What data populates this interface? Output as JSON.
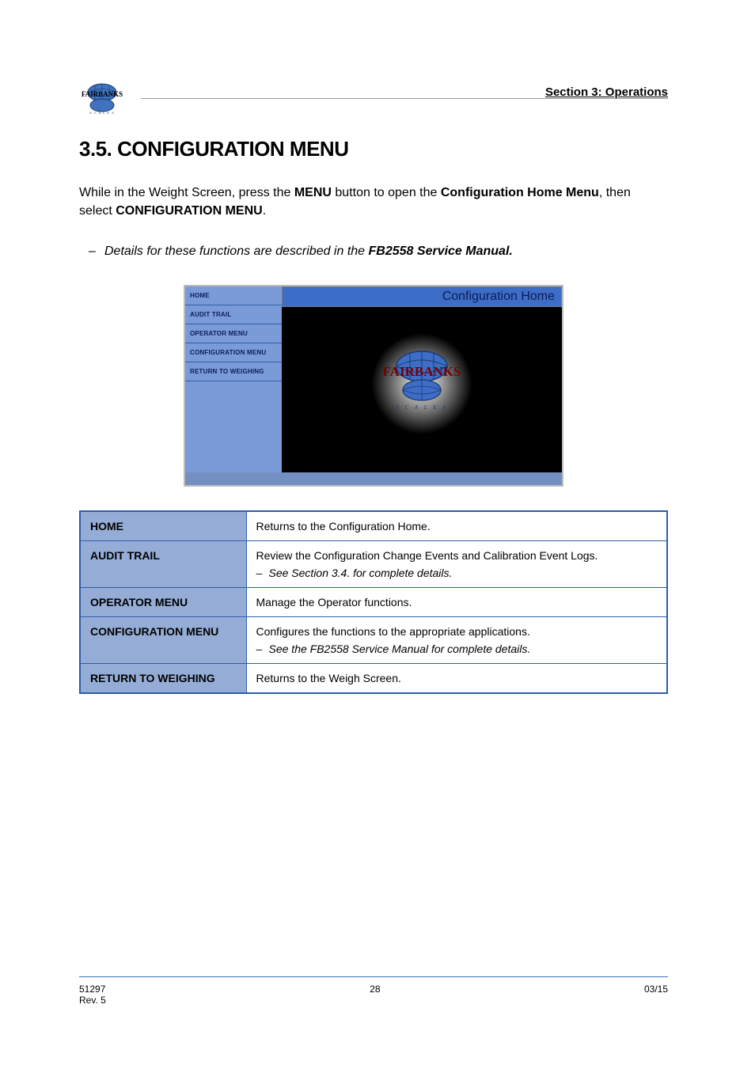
{
  "header": {
    "section_label": "Section 3:  Operations"
  },
  "heading": "3.5.  CONFIGURATION MENU",
  "intro_sentence_1a": "While in the Weight Screen, press the ",
  "intro_button_name": "MENU",
  "intro_sentence_1b": " button to open the ",
  "intro_config_home_1": "Configuration Home Menu",
  "intro_sentence_1c": ", then select",
  "intro_config_menu_1": " CONFIGURATION MENU",
  "intro_period": ".",
  "bullet_pre": "Details for these functions are described in the",
  "bullet_link": " FB2558 Service Manual.",
  "ui": {
    "sidebar": {
      "home": "HOME",
      "audit_trail": "AUDIT TRAIL",
      "operator_menu": "OPERATOR MENU",
      "configuration_menu": "CONFIGURATION MENU",
      "return_to_weighing": "RETURN TO WEIGHING"
    },
    "titlebar": "Configuration Home",
    "logo_text": "FAIRBANKS",
    "logo_sub": "SCALES"
  },
  "table": {
    "rows": [
      {
        "label": "HOME",
        "desc_main": "Returns to the Configuration Home.",
        "sub": null
      },
      {
        "label": "AUDIT TRAIL",
        "desc_main": "Review the Configuration Change Events and Calibration Event Logs.",
        "sub": "See Section 3.4. for complete details."
      },
      {
        "label": "OPERATOR MENU",
        "desc_main": "Manage the Operator functions.",
        "sub": null
      },
      {
        "label": "CONFIGURATION MENU",
        "desc_main": "Configures the functions to the appropriate applications.",
        "sub": "See the FB2558 Service Manual for complete details."
      },
      {
        "label": "RETURN TO WEIGHING",
        "desc_main": "Returns to the Weigh Screen.",
        "sub": null
      }
    ]
  },
  "footer": {
    "left_line1": "51297 ",
    "left_line2": "Rev. 5",
    "center": "28",
    "right_line1": "03/15",
    "right_line2": ""
  }
}
